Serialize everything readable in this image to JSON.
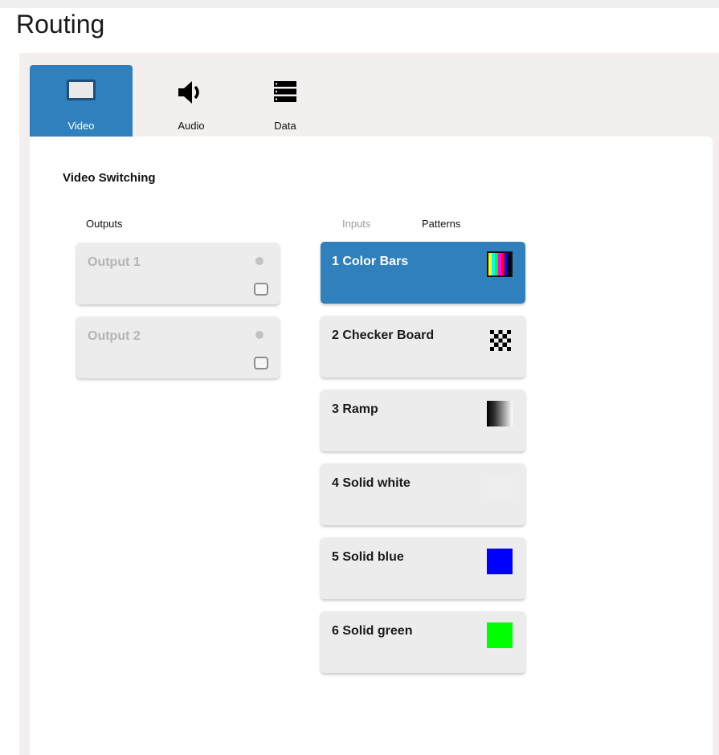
{
  "page": {
    "title": "Routing"
  },
  "tabs": [
    {
      "label": "Video",
      "icon": "monitor-icon",
      "active": true
    },
    {
      "label": "Audio",
      "icon": "speaker-icon",
      "active": false
    },
    {
      "label": "Data",
      "icon": "server-stack-icon",
      "active": false
    }
  ],
  "section": {
    "title": "Video Switching"
  },
  "outputs": {
    "header": "Outputs",
    "items": [
      {
        "label": "Output 1"
      },
      {
        "label": "Output 2"
      }
    ]
  },
  "sources": {
    "inputs_tab": "Inputs",
    "patterns_tab": "Patterns",
    "patterns": [
      {
        "label": "1 Color Bars",
        "selected": true,
        "swatch": "color-bars-icon"
      },
      {
        "label": "2 Checker Board",
        "selected": false,
        "swatch": "checkerboard-icon"
      },
      {
        "label": "3 Ramp",
        "selected": false,
        "swatch": "ramp-icon"
      },
      {
        "label": "4 Solid white",
        "selected": false,
        "swatch": "solid-white-icon",
        "color": "#eeeeee"
      },
      {
        "label": "5 Solid blue",
        "selected": false,
        "swatch": "solid-blue-icon",
        "color": "#0000ff"
      },
      {
        "label": "6 Solid green",
        "selected": false,
        "swatch": "solid-green-icon",
        "color": "#00ff00"
      }
    ]
  },
  "colors": {
    "accent": "#2f80bd",
    "card": "#ececec",
    "frame": "#f2efee"
  }
}
